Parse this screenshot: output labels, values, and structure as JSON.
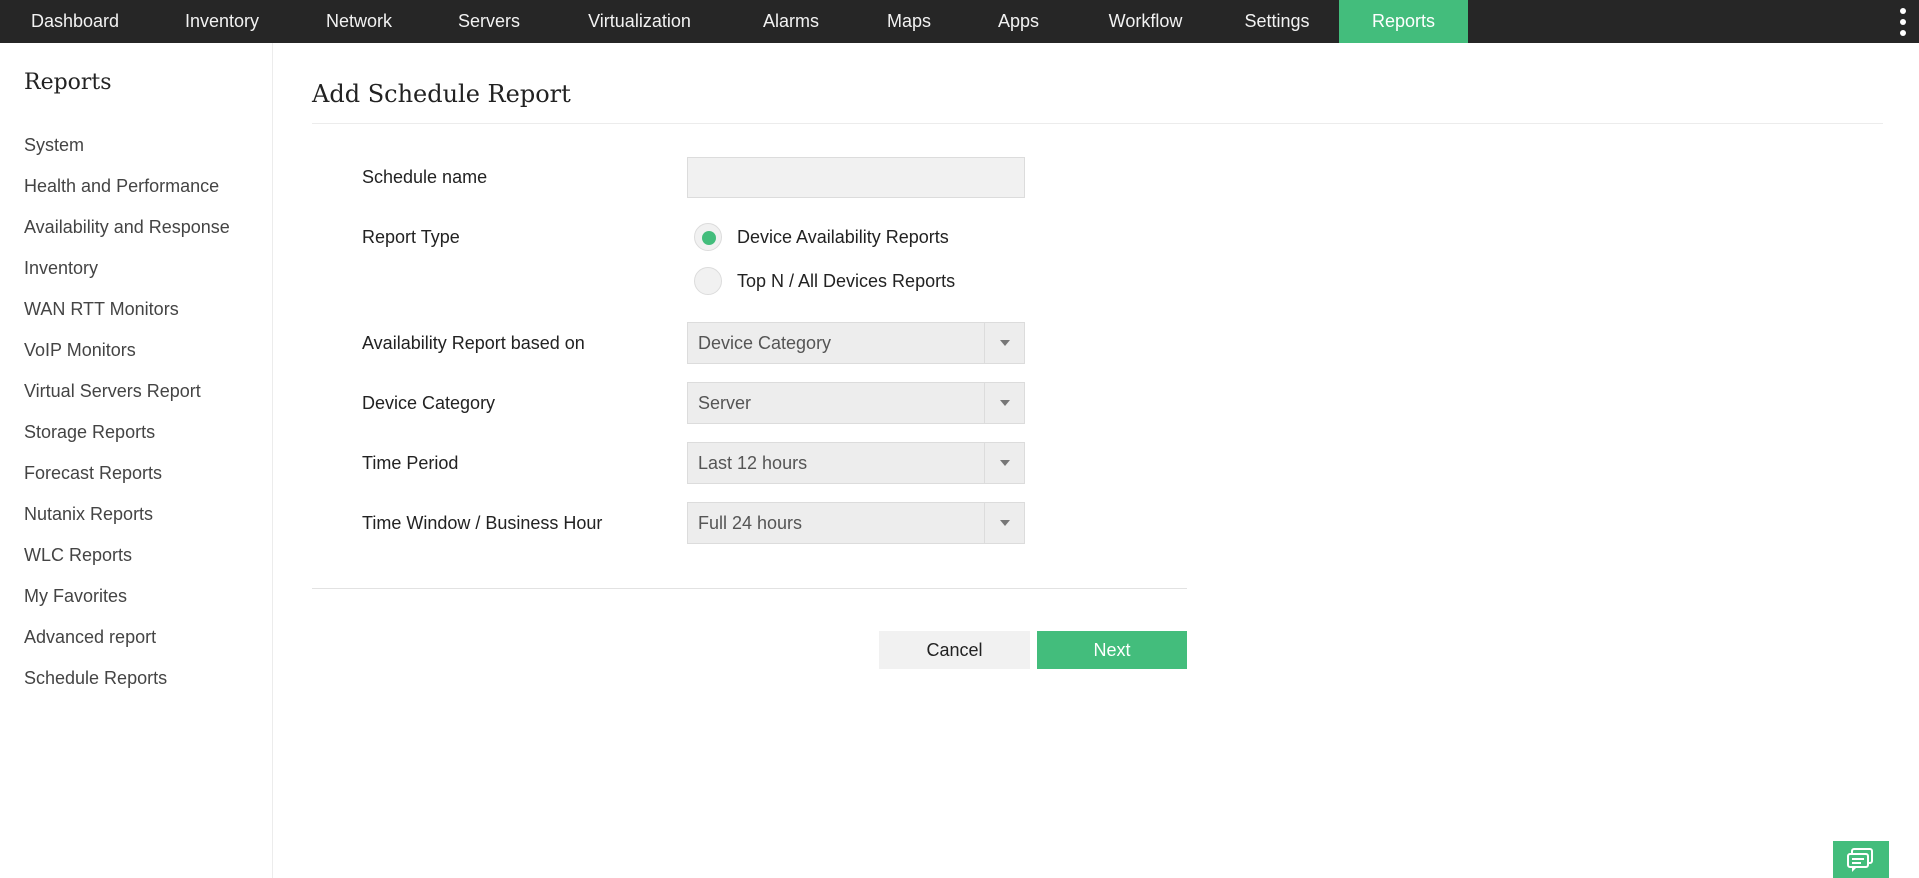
{
  "nav": {
    "items": [
      {
        "label": "Dashboard"
      },
      {
        "label": "Inventory"
      },
      {
        "label": "Network"
      },
      {
        "label": "Servers"
      },
      {
        "label": "Virtualization"
      },
      {
        "label": "Alarms"
      },
      {
        "label": "Maps"
      },
      {
        "label": "Apps"
      },
      {
        "label": "Workflow"
      },
      {
        "label": "Settings"
      },
      {
        "label": "Reports",
        "active": true
      }
    ],
    "more_icon": "more-vertical-icon"
  },
  "sidebar": {
    "title": "Reports",
    "items": [
      {
        "label": "System"
      },
      {
        "label": "Health and Performance"
      },
      {
        "label": "Availability and Response"
      },
      {
        "label": "Inventory"
      },
      {
        "label": "WAN RTT Monitors"
      },
      {
        "label": "VoIP Monitors"
      },
      {
        "label": "Virtual Servers Report"
      },
      {
        "label": "Storage Reports"
      },
      {
        "label": "Forecast Reports"
      },
      {
        "label": "Nutanix Reports"
      },
      {
        "label": "WLC Reports"
      },
      {
        "label": "My Favorites"
      },
      {
        "label": "Advanced report"
      },
      {
        "label": "Schedule Reports"
      }
    ]
  },
  "page": {
    "title": "Add Schedule Report"
  },
  "form": {
    "schedule_name": {
      "label": "Schedule name",
      "value": "",
      "placeholder": ""
    },
    "report_type": {
      "label": "Report Type",
      "options": [
        {
          "label": "Device Availability Reports",
          "checked": true
        },
        {
          "label": "Top N / All Devices Reports",
          "checked": false
        }
      ]
    },
    "availability_based_on": {
      "label": "Availability Report based on",
      "value": "Device Category"
    },
    "device_category": {
      "label": "Device Category",
      "value": "Server"
    },
    "time_period": {
      "label": "Time Period",
      "value": "Last 12 hours"
    },
    "time_window": {
      "label": "Time Window / Business Hour",
      "value": "Full 24 hours"
    }
  },
  "actions": {
    "cancel_label": "Cancel",
    "next_label": "Next"
  },
  "chat": {
    "icon": "chat-bubble-icon"
  },
  "colors": {
    "accent": "#43bd7c",
    "topbar": "#262626"
  }
}
